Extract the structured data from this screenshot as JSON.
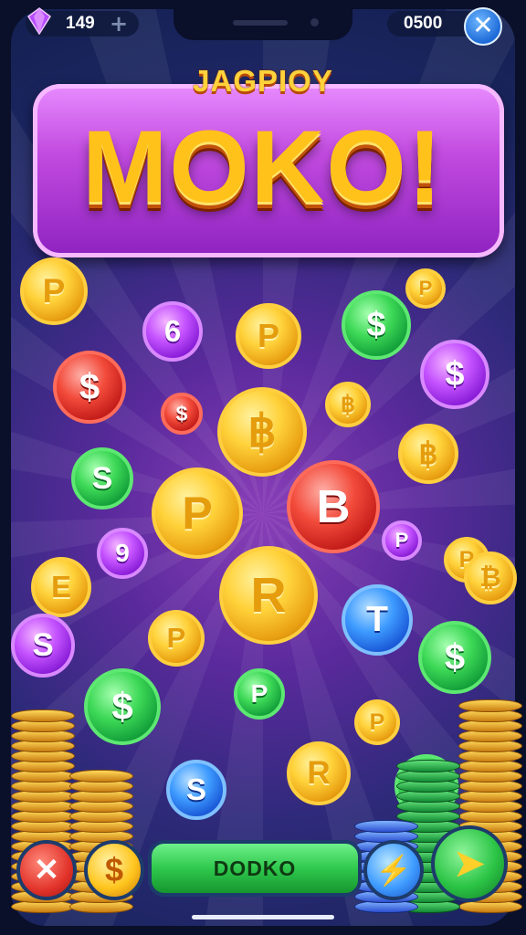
{
  "hud": {
    "gems": "149",
    "gems_add": "+",
    "coins": "0500",
    "close_label": "✕"
  },
  "title": {
    "subtitle": "JAGPIOY",
    "main": "MOKO!"
  },
  "coins": [
    {
      "letter": "P",
      "color": "gold"
    },
    {
      "letter": "6",
      "color": "purple"
    },
    {
      "letter": "P",
      "color": "gold"
    },
    {
      "letter": "$",
      "color": "green"
    },
    {
      "letter": "$",
      "color": "red"
    },
    {
      "letter": "$",
      "color": "red"
    },
    {
      "letter": "฿",
      "color": "gold"
    },
    {
      "letter": "฿",
      "color": "gold"
    },
    {
      "letter": "$",
      "color": "purple"
    },
    {
      "letter": "S",
      "color": "green"
    },
    {
      "letter": "P",
      "color": "gold"
    },
    {
      "letter": "B",
      "color": "red"
    },
    {
      "letter": "฿",
      "color": "gold"
    },
    {
      "letter": "9",
      "color": "purple"
    },
    {
      "letter": "R",
      "color": "gold"
    },
    {
      "letter": "E",
      "color": "gold"
    },
    {
      "letter": "T",
      "color": "blue"
    },
    {
      "letter": "$",
      "color": "green"
    },
    {
      "letter": "S",
      "color": "purple"
    },
    {
      "letter": "P",
      "color": "gold"
    },
    {
      "letter": "$",
      "color": "green"
    },
    {
      "letter": "P",
      "color": "green"
    },
    {
      "letter": "P",
      "color": "gold"
    },
    {
      "letter": "R",
      "color": "gold"
    },
    {
      "letter": "S",
      "color": "blue"
    },
    {
      "letter": "P",
      "color": "gold"
    },
    {
      "letter": "₿",
      "color": "gold"
    },
    {
      "letter": "$",
      "color": "green"
    },
    {
      "letter": "P",
      "color": "purple"
    },
    {
      "letter": "P",
      "color": "gold"
    }
  ],
  "controls": {
    "cancel": "✕",
    "coin": "$",
    "main_button": "DODKO",
    "bolt": "⚡",
    "send": "➤"
  },
  "colors": {
    "gold": "#ffc21a",
    "green": "#3ed957",
    "red": "#f24a3a",
    "purple": "#c452ff",
    "blue": "#3e9bff"
  }
}
